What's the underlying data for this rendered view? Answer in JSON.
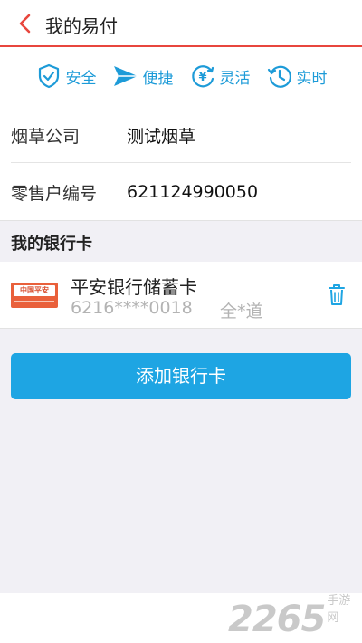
{
  "header": {
    "title": "我的易付"
  },
  "features": [
    {
      "label": "安全",
      "icon": "shield-check-icon"
    },
    {
      "label": "便捷",
      "icon": "paper-plane-icon"
    },
    {
      "label": "灵活",
      "icon": "yen-cycle-icon"
    },
    {
      "label": "实时",
      "icon": "clock-history-icon"
    }
  ],
  "info": {
    "company_label": "烟草公司",
    "company_value": "测试烟草",
    "retailer_label": "零售户编号",
    "retailer_value": "621124990050"
  },
  "bank_section": {
    "title": "我的银行卡",
    "cards": [
      {
        "bank_name": "平安银行储蓄卡",
        "number": "6216****0018",
        "holder": "全*道",
        "logo_text": "中国平安"
      }
    ]
  },
  "add_button": {
    "label": "添加银行卡"
  },
  "watermark": {
    "number": "2265",
    "suffix": "手游网"
  },
  "colors": {
    "accent_blue": "#1ea5e3",
    "header_red": "#e8463d",
    "section_bg": "#f1f0f5"
  }
}
